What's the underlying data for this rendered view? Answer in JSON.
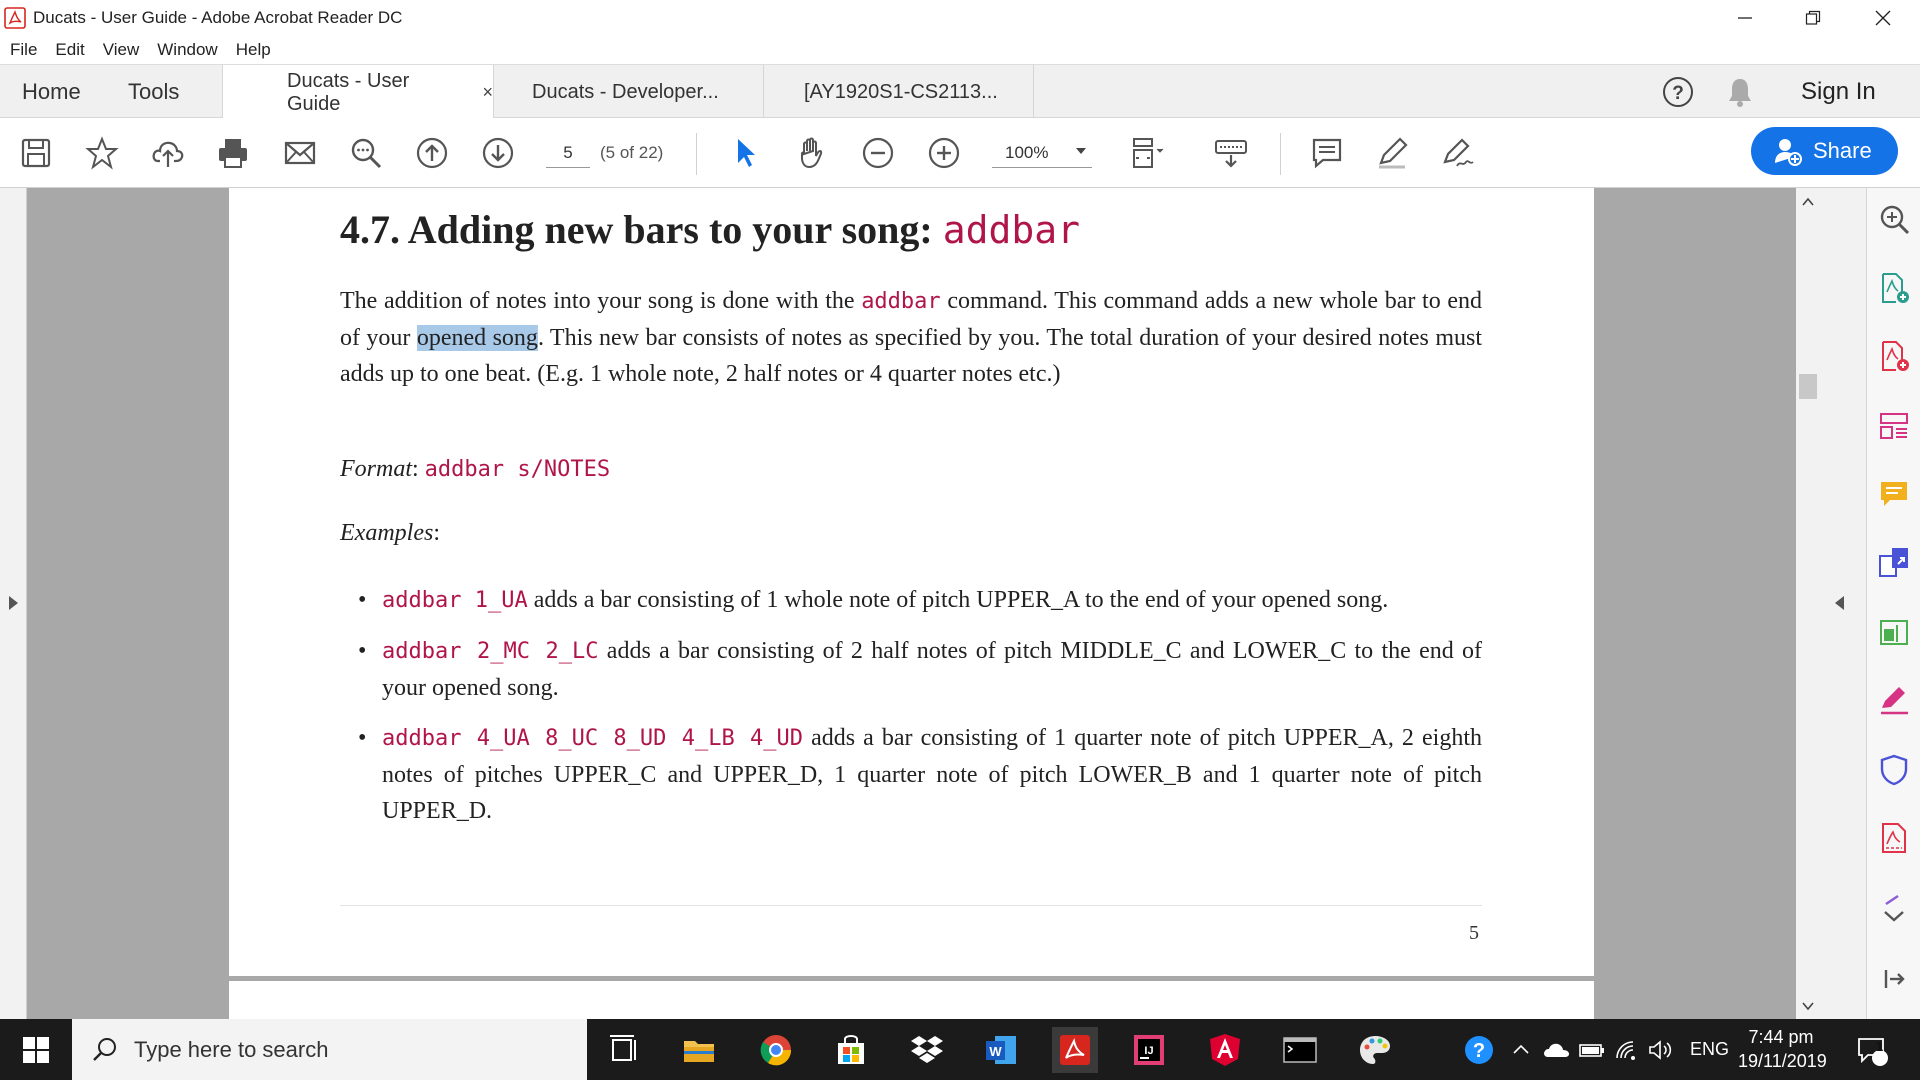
{
  "window": {
    "title": "Ducats - User Guide - Adobe Acrobat Reader DC"
  },
  "menu": [
    {
      "label": "File"
    },
    {
      "label": "Edit"
    },
    {
      "label": "View"
    },
    {
      "label": "Window"
    },
    {
      "label": "Help"
    }
  ],
  "tabs": {
    "home": "Home",
    "tools": "Tools",
    "documents": [
      {
        "label": "Ducats - User Guide",
        "close": "×"
      },
      {
        "label": "Ducats - Developer..."
      },
      {
        "label": "[AY1920S1-CS2113..."
      }
    ],
    "sign_in": "Sign In"
  },
  "toolbar": {
    "page_number": "5",
    "page_of": "(5 of 22)",
    "zoom": "100%",
    "share_label": "Share"
  },
  "document": {
    "heading_text": "4.7. Adding new bars to your song: ",
    "heading_code": "addbar",
    "para": {
      "t1": "The addition of notes into your song is done with the ",
      "code1": "addbar",
      "t2": " command. This command adds a new whole bar to end of your ",
      "highlight": "opened song",
      "t3": ". This new bar consists of notes as specified by you. The total duration of your desired notes must adds up to one beat. (E.g. 1 whole note, 2 half notes or 4 quarter notes etc.)"
    },
    "format_label": "Format",
    "format_sep": ": ",
    "format_code": "addbar s/NOTES",
    "examples_label": "Examples",
    "examples_sep": ":",
    "examples": [
      {
        "code": "addbar 1_UA",
        "text": " adds a bar consisting of 1 whole note of pitch UPPER_A to the end of your opened song."
      },
      {
        "code": "addbar 2_MC 2_LC",
        "text": " adds a bar consisting of 2 half notes of pitch MIDDLE_C and LOWER_C to the end of your opened song."
      },
      {
        "code": "addbar 4_UA 8_UC 8_UD 4_LB 4_UD",
        "text": " adds a bar consisting of 1 quarter note of pitch UPPER_A, 2 eighth notes of pitches UPPER_C and UPPER_D, 1 quarter note of pitch LOWER_B and 1 quarter note of pitch UPPER_D."
      }
    ],
    "page_footer_number": "5"
  },
  "taskbar": {
    "search_placeholder": "Type here to search",
    "language": "ENG",
    "time": "7:44 pm",
    "date": "19/11/2019",
    "notification_count": "1"
  },
  "colors": {
    "accent": "#1473e6",
    "code": "#b0154a",
    "highlight": "#a9c9e8",
    "acrobat_red": "#d7261e"
  }
}
